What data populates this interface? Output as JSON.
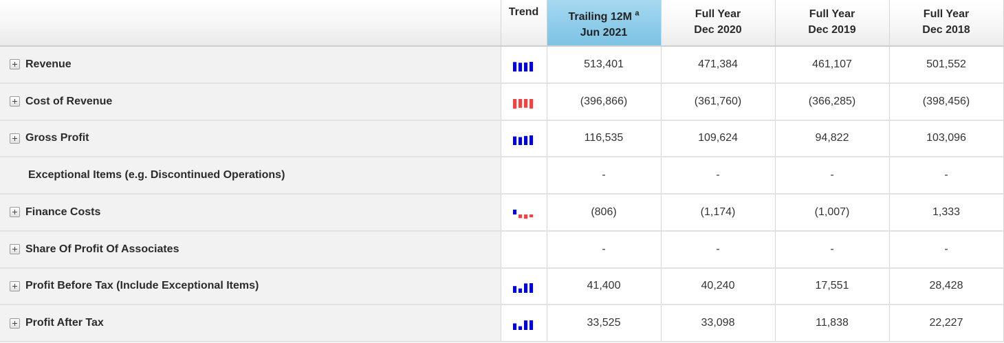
{
  "header": {
    "trend_label": "Trend",
    "columns": [
      {
        "line1": "Trailing 12M",
        "sup": "a",
        "line2": "Jun 2021",
        "active": true
      },
      {
        "line1": "Full Year",
        "line2": "Dec 2020"
      },
      {
        "line1": "Full Year",
        "line2": "Dec 2019"
      },
      {
        "line1": "Full Year",
        "line2": "Dec 2018"
      }
    ]
  },
  "colors": {
    "positive": "#0000dd",
    "negative": "#ee4444",
    "active_header": "#8ccbe9"
  },
  "rows": [
    {
      "label": "Revenue",
      "expandable": true,
      "values": [
        "513,401",
        "471,384",
        "461,107",
        "501,552"
      ],
      "trend": {
        "numbers": [
          501552,
          461107,
          471384,
          513401
        ]
      }
    },
    {
      "label": "Cost of Revenue",
      "expandable": true,
      "values": [
        "(396,866)",
        "(361,760)",
        "(366,285)",
        "(398,456)"
      ],
      "trend": {
        "numbers": [
          -398456,
          -366285,
          -361760,
          -396866
        ]
      }
    },
    {
      "label": "Gross Profit",
      "expandable": true,
      "values": [
        "116,535",
        "109,624",
        "94,822",
        "103,096"
      ],
      "trend": {
        "numbers": [
          103096,
          94822,
          109624,
          116535
        ]
      }
    },
    {
      "label": "Exceptional Items (e.g. Discontinued Operations)",
      "expandable": false,
      "values": [
        "-",
        "-",
        "-",
        "-"
      ],
      "trend": null
    },
    {
      "label": "Finance Costs",
      "expandable": true,
      "values": [
        "(806)",
        "(1,174)",
        "(1,007)",
        "1,333"
      ],
      "trend": {
        "numbers": [
          1333,
          -1007,
          -1174,
          -806
        ]
      }
    },
    {
      "label": "Share Of Profit Of Associates",
      "expandable": true,
      "values": [
        "-",
        "-",
        "-",
        "-"
      ],
      "trend": null
    },
    {
      "label": "Profit Before Tax (Include Exceptional Items)",
      "expandable": true,
      "values": [
        "41,400",
        "40,240",
        "17,551",
        "28,428"
      ],
      "trend": {
        "numbers": [
          28428,
          17551,
          40240,
          41400
        ]
      }
    },
    {
      "label": "Profit After Tax",
      "expandable": true,
      "values": [
        "33,525",
        "33,098",
        "11,838",
        "22,227"
      ],
      "trend": {
        "numbers": [
          22227,
          11838,
          33098,
          33525
        ]
      }
    }
  ]
}
